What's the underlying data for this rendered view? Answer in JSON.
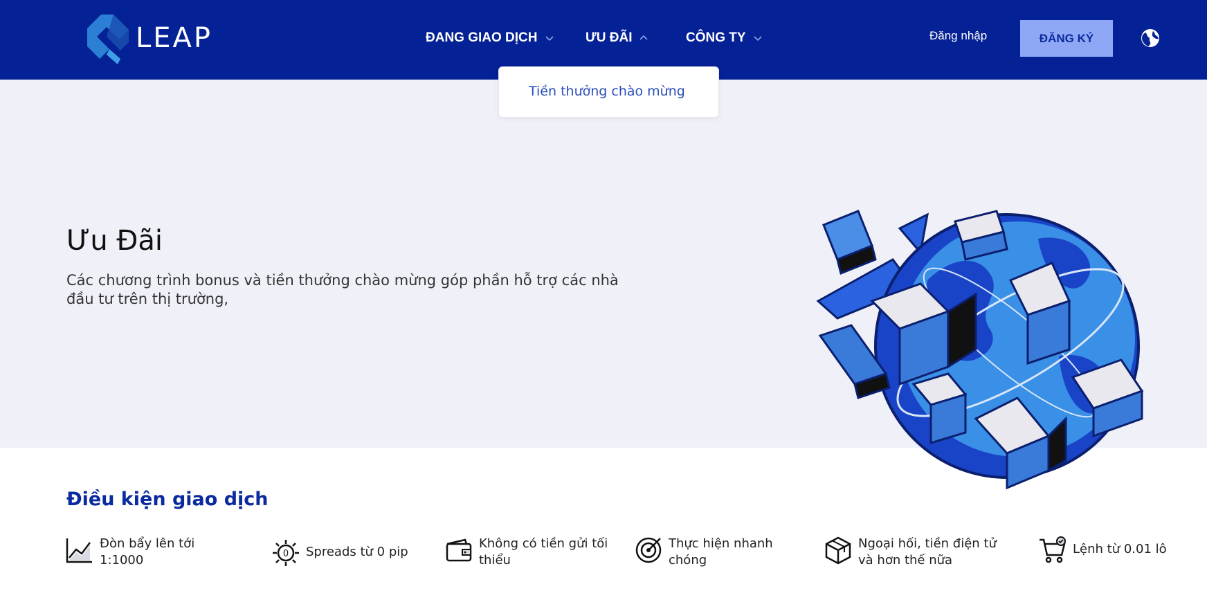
{
  "brand": {
    "name": "LEAP"
  },
  "nav": {
    "trading": "ĐANG GIAO DỊCH",
    "promotions": "ƯU ĐÃI",
    "company": "CÔNG TY",
    "login": "Đăng nhập",
    "signup": "ĐĂNG KÝ"
  },
  "dropdown": {
    "items": [
      "Tiền thưởng chào mừng"
    ]
  },
  "hero": {
    "title": "Ưu Đãi",
    "description": "Các chương trình bonus và tiền thưởng chào mừng góp phần hỗ trợ các nhà đầu tư trên thị trường,"
  },
  "conditions": {
    "title": "Điều kiện giao dịch",
    "items": [
      {
        "icon": "chart-line-icon",
        "text": "Đòn bẩy lên tới 1:1000"
      },
      {
        "icon": "zero-spread-icon",
        "text": "Spreads từ 0 pip"
      },
      {
        "icon": "wallet-icon",
        "text": "Không có tiền gửi tối thiểu"
      },
      {
        "icon": "target-icon",
        "text": "Thực hiện nhanh chóng"
      },
      {
        "icon": "cube-icon",
        "text": "Ngoại hối, tiền điện tử và hơn thế nữa"
      },
      {
        "icon": "cart-icon",
        "text": "Lệnh từ 0.01 lô"
      }
    ]
  },
  "colors": {
    "header": "#052196",
    "accent": "#0a2a9f",
    "signup_bg": "#8fa8f6",
    "hero_bg": "#f0f1f8"
  }
}
